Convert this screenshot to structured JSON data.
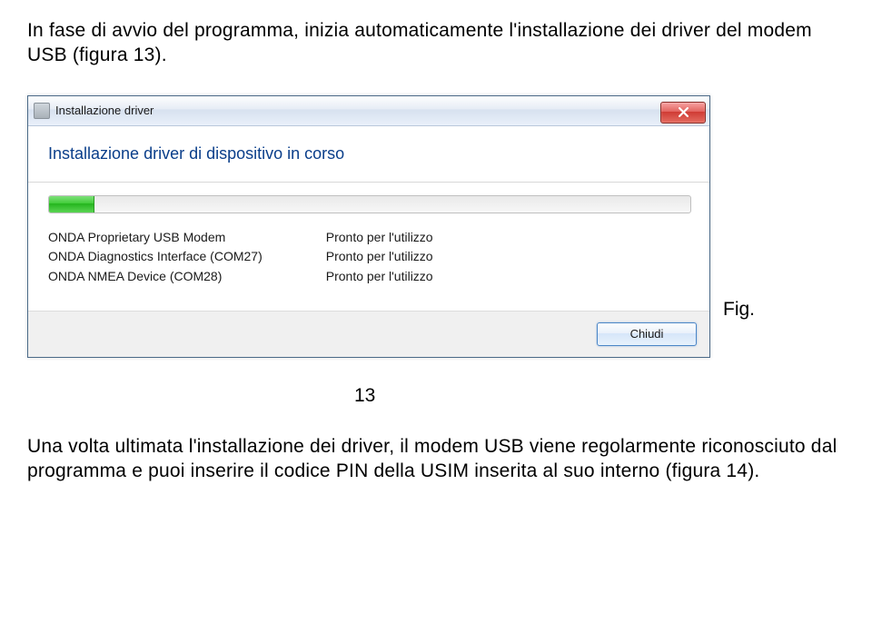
{
  "intro": "In fase di avvio del programma, inizia automaticamente l'installazione dei driver del modem USB (figura 13).",
  "dialog": {
    "title": "Installazione driver",
    "heading": "Installazione driver di dispositivo in corso",
    "devices": [
      "ONDA Proprietary USB Modem",
      "ONDA Diagnostics Interface (COM27)",
      "ONDA NMEA Device (COM28)"
    ],
    "statuses": [
      "Pronto per l'utilizzo",
      "Pronto per l'utilizzo",
      "Pronto per l'utilizzo"
    ],
    "close_label": "Chiudi"
  },
  "figure": {
    "label": "Fig.",
    "number": "13"
  },
  "outro": "Una volta ultimata l'installazione dei driver, il modem USB viene regolarmente riconosciuto dal programma e puoi inserire il codice PIN della USIM inserita al suo interno (figura 14)."
}
